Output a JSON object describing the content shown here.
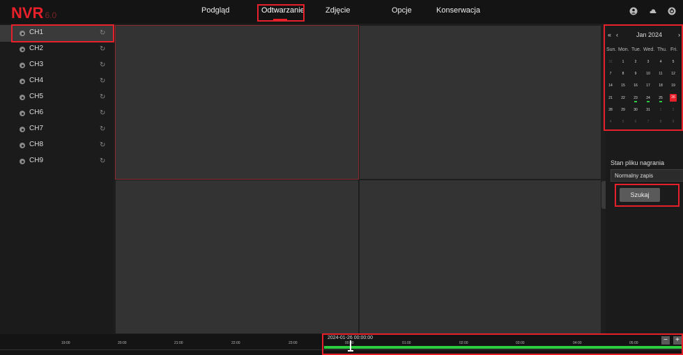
{
  "brand": {
    "name": "NVR",
    "version": "6.0"
  },
  "nav": [
    {
      "label": "Podgląd"
    },
    {
      "label": "Odtwarzanie",
      "active": true
    },
    {
      "label": "Zdjęcie"
    },
    {
      "label": "Opcje"
    },
    {
      "label": "Konserwacja"
    }
  ],
  "toolbar_icons": [
    "user-icon",
    "cloud-icon",
    "power-icon"
  ],
  "channels": [
    {
      "label": "CH1",
      "selected": true
    },
    {
      "label": "CH2"
    },
    {
      "label": "CH3"
    },
    {
      "label": "CH4"
    },
    {
      "label": "CH5"
    },
    {
      "label": "CH6"
    },
    {
      "label": "CH7"
    },
    {
      "label": "CH8"
    },
    {
      "label": "CH9"
    }
  ],
  "calendar": {
    "nav_prev_year": "«",
    "nav_prev_month": "‹",
    "nav_next_month": "›",
    "month_label": "Jan 2024",
    "weekdays": [
      "Sun.",
      "Mon.",
      "Tue.",
      "Wed.",
      "Thu.",
      "Fri."
    ],
    "weeks": [
      [
        "31",
        "1",
        "2",
        "3",
        "4",
        "5"
      ],
      [
        "7",
        "8",
        "9",
        "10",
        "11",
        "12"
      ],
      [
        "14",
        "15",
        "16",
        "17",
        "18",
        "19"
      ],
      [
        "21",
        "22",
        "23",
        "24",
        "25",
        "26"
      ],
      [
        "28",
        "29",
        "30",
        "31",
        "1",
        "2"
      ],
      [
        "4",
        "5",
        "6",
        "7",
        "8",
        "9"
      ]
    ],
    "selected_day": "26",
    "record_days": [
      "23",
      "24",
      "25"
    ]
  },
  "record_status": {
    "label": "Stan pliku nagrania",
    "value": "Normalny zapis"
  },
  "search_button": "Szukaj",
  "timeline": {
    "current": "2024-01-26 00:00:00",
    "ticks": [
      "19:00",
      "20:00",
      "21:00",
      "22:00",
      "23:00",
      "00:00",
      "01:00",
      "02:00",
      "03:00",
      "04:00",
      "05:00"
    ],
    "zoom_out": "−",
    "zoom_in": "+"
  },
  "colors": {
    "accent": "#e8202a",
    "recording": "#2ecc40",
    "background": "#1e1e1e"
  }
}
